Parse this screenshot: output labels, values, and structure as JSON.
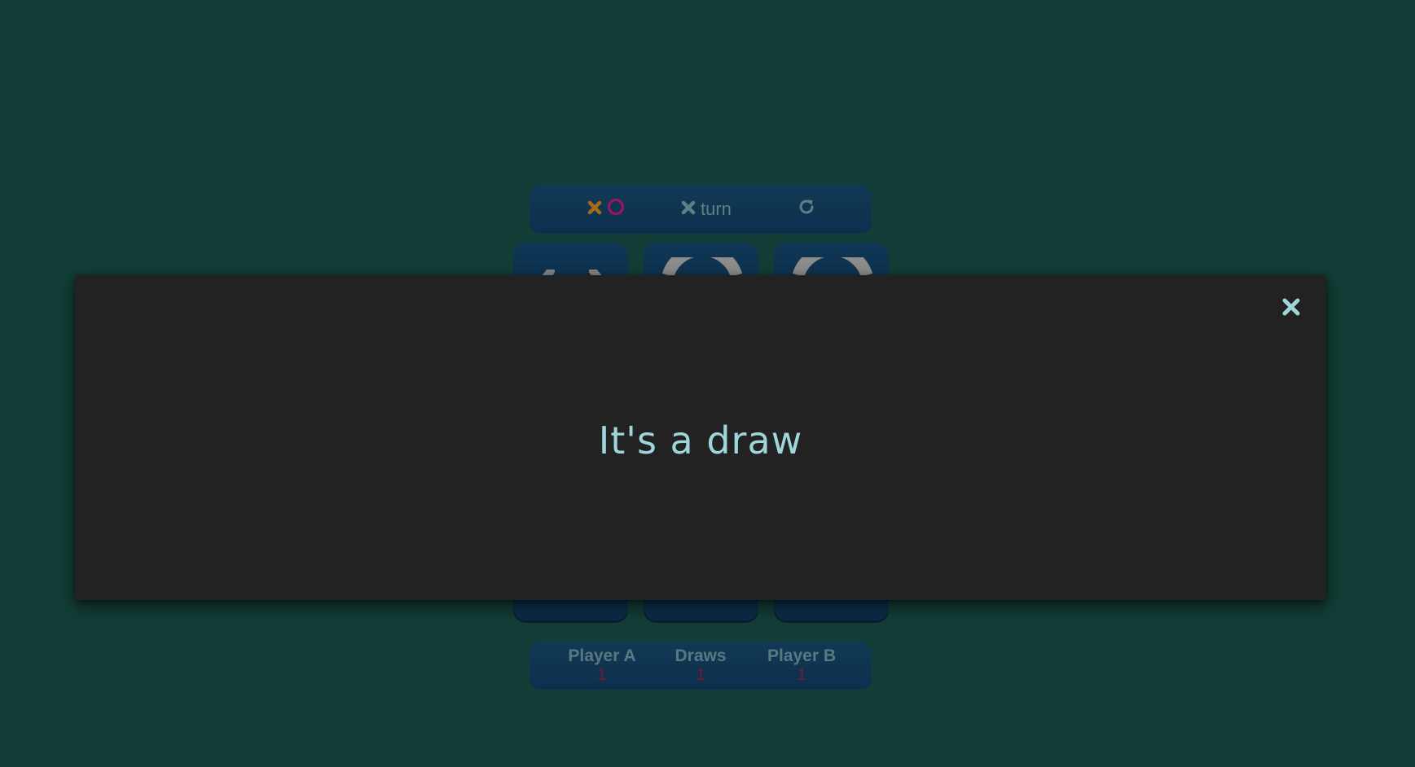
{
  "header": {
    "logo_icons": [
      "x-icon",
      "o-icon"
    ],
    "turn_icon": "x-icon",
    "turn_label": "turn",
    "restart_icon": "restart-icon"
  },
  "board": {
    "visible_marks": [
      "x",
      "o",
      "o"
    ]
  },
  "scoreboard": {
    "player_a_label": "Player A",
    "player_a_value": "1",
    "draws_label": "Draws",
    "draws_value": "1",
    "player_b_label": "Player B",
    "player_b_value": "1"
  },
  "modal": {
    "message": "It's a draw",
    "close_icon": "close-icon"
  },
  "colors": {
    "background": "#133e37",
    "panel": "#0e3150",
    "x_accent": "#a56c13",
    "o_accent": "#a3106c",
    "modal_background": "#222222",
    "modal_text": "#9fd6dc",
    "score_value": "#7a1731"
  }
}
